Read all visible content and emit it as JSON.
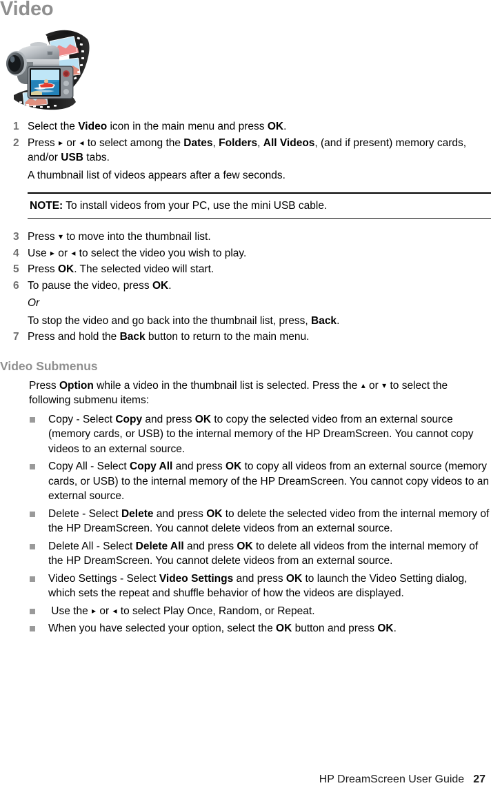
{
  "page": {
    "title": "Video",
    "hero_icon": "camcorder-filmstrip-image"
  },
  "steps": [
    {
      "num": "1",
      "parts": [
        {
          "t": "Select the ",
          "b": false
        },
        {
          "t": "Video",
          "b": true
        },
        {
          "t": " icon in the main menu and press ",
          "b": false
        },
        {
          "t": "OK",
          "b": true
        },
        {
          "t": ".",
          "b": false
        }
      ]
    },
    {
      "num": "2",
      "parts": [
        {
          "t": "Press ",
          "b": false
        },
        {
          "t": "▸",
          "b": false,
          "arrow": true
        },
        {
          "t": " or ",
          "b": false
        },
        {
          "t": "◂",
          "b": false,
          "arrow": true
        },
        {
          "t": " to select among the ",
          "b": false
        },
        {
          "t": "Dates",
          "b": true
        },
        {
          "t": ", ",
          "b": false
        },
        {
          "t": "Folders",
          "b": true
        },
        {
          "t": ", ",
          "b": false
        },
        {
          "t": "All Videos",
          "b": true
        },
        {
          "t": ", (and if present) memory cards, and/or ",
          "b": false
        },
        {
          "t": "USB",
          "b": true
        },
        {
          "t": " tabs.",
          "b": false
        }
      ],
      "extra": "A thumbnail list of videos appears after a few seconds."
    },
    {
      "num": "3",
      "parts": [
        {
          "t": "Press ",
          "b": false
        },
        {
          "t": "▾",
          "b": false,
          "arrow": true
        },
        {
          "t": " to move into the thumbnail list.",
          "b": false
        }
      ]
    },
    {
      "num": "4",
      "parts": [
        {
          "t": "Use ",
          "b": false
        },
        {
          "t": "▸",
          "b": false,
          "arrow": true
        },
        {
          "t": " or ",
          "b": false
        },
        {
          "t": "◂",
          "b": false,
          "arrow": true
        },
        {
          "t": " to select the video you wish to play.",
          "b": false
        }
      ]
    },
    {
      "num": "5",
      "parts": [
        {
          "t": "Press ",
          "b": false
        },
        {
          "t": "OK",
          "b": true
        },
        {
          "t": ". The selected video will start.",
          "b": false
        }
      ]
    },
    {
      "num": "6",
      "parts": [
        {
          "t": "To pause the video, press ",
          "b": false
        },
        {
          "t": "OK",
          "b": true
        },
        {
          "t": ".",
          "b": false
        }
      ],
      "or_label": "Or",
      "alt_parts": [
        {
          "t": "To stop the video and go back into the thumbnail list, press, ",
          "b": false
        },
        {
          "t": "Back",
          "b": true
        },
        {
          "t": ".",
          "b": false
        }
      ]
    },
    {
      "num": "7",
      "parts": [
        {
          "t": "Press and hold the ",
          "b": false
        },
        {
          "t": "Back",
          "b": true
        },
        {
          "t": " button to return to the main menu.",
          "b": false
        }
      ]
    }
  ],
  "note": {
    "label": "NOTE:",
    "text": " To install videos from your PC, use the mini USB cable."
  },
  "submenus": {
    "title": "Video Submenus",
    "intro_parts": [
      {
        "t": "Press ",
        "b": false
      },
      {
        "t": "Option",
        "b": true
      },
      {
        "t": " while a video in the thumbnail list is selected. Press the ",
        "b": false
      },
      {
        "t": "▴",
        "b": false,
        "arrow": true
      },
      {
        "t": " or ",
        "b": false
      },
      {
        "t": "▾",
        "b": false,
        "arrow": true
      },
      {
        "t": " to select the following submenu items:",
        "b": false
      }
    ],
    "items": [
      {
        "parts": [
          {
            "t": "Copy - Select ",
            "b": false
          },
          {
            "t": "Copy",
            "b": true
          },
          {
            "t": " and press ",
            "b": false
          },
          {
            "t": "OK",
            "b": true
          },
          {
            "t": " to copy the selected video from an external source (memory cards, or USB) to the internal memory of the HP DreamScreen. You cannot copy videos to an external source.",
            "b": false
          }
        ]
      },
      {
        "parts": [
          {
            "t": "Copy All - Select ",
            "b": false
          },
          {
            "t": "Copy All",
            "b": true
          },
          {
            "t": " and press ",
            "b": false
          },
          {
            "t": "OK",
            "b": true
          },
          {
            "t": " to copy all videos from an external source (memory cards, or USB) to the internal memory of the HP DreamScreen. You cannot copy videos to an external source.",
            "b": false
          }
        ]
      },
      {
        "parts": [
          {
            "t": "Delete - Select ",
            "b": false
          },
          {
            "t": "Delete",
            "b": true
          },
          {
            "t": " and press ",
            "b": false
          },
          {
            "t": "OK",
            "b": true
          },
          {
            "t": " to delete the selected video from the internal memory of the HP DreamScreen. You cannot delete videos from an external source.",
            "b": false
          }
        ]
      },
      {
        "parts": [
          {
            "t": "Delete All - Select ",
            "b": false
          },
          {
            "t": "Delete All",
            "b": true
          },
          {
            "t": " and press ",
            "b": false
          },
          {
            "t": "OK",
            "b": true
          },
          {
            "t": " to delete all videos from the internal memory of the HP DreamScreen. You cannot delete videos from an external source.",
            "b": false
          }
        ]
      },
      {
        "parts": [
          {
            "t": "Video Settings - Select ",
            "b": false
          },
          {
            "t": "Video Settings",
            "b": true
          },
          {
            "t": " and press ",
            "b": false
          },
          {
            "t": "OK",
            "b": true
          },
          {
            "t": " to launch the Video Setting dialog, which sets the repeat and shuffle behavior of how the videos are displayed.",
            "b": false
          }
        ]
      },
      {
        "parts": [
          {
            "t": " Use the ",
            "b": false
          },
          {
            "t": "▸",
            "b": false,
            "arrow": true
          },
          {
            "t": " or ",
            "b": false
          },
          {
            "t": "◂",
            "b": false,
            "arrow": true
          },
          {
            "t": " to select Play Once, Random, or Repeat.",
            "b": false
          }
        ]
      },
      {
        "parts": [
          {
            "t": "When you have selected your option, select the ",
            "b": false
          },
          {
            "t": "OK",
            "b": true
          },
          {
            "t": " button and press ",
            "b": false
          },
          {
            "t": "OK",
            "b": true
          },
          {
            "t": ".",
            "b": false
          }
        ]
      }
    ]
  },
  "footer": {
    "guide_title": "HP DreamScreen User Guide",
    "page_number": "27"
  },
  "colors": {
    "heading_gray": "#8f8f8f",
    "bullet_gray": "#9a9a9a",
    "step_number_gray": "#6f6f6f",
    "text_black": "#000000"
  }
}
